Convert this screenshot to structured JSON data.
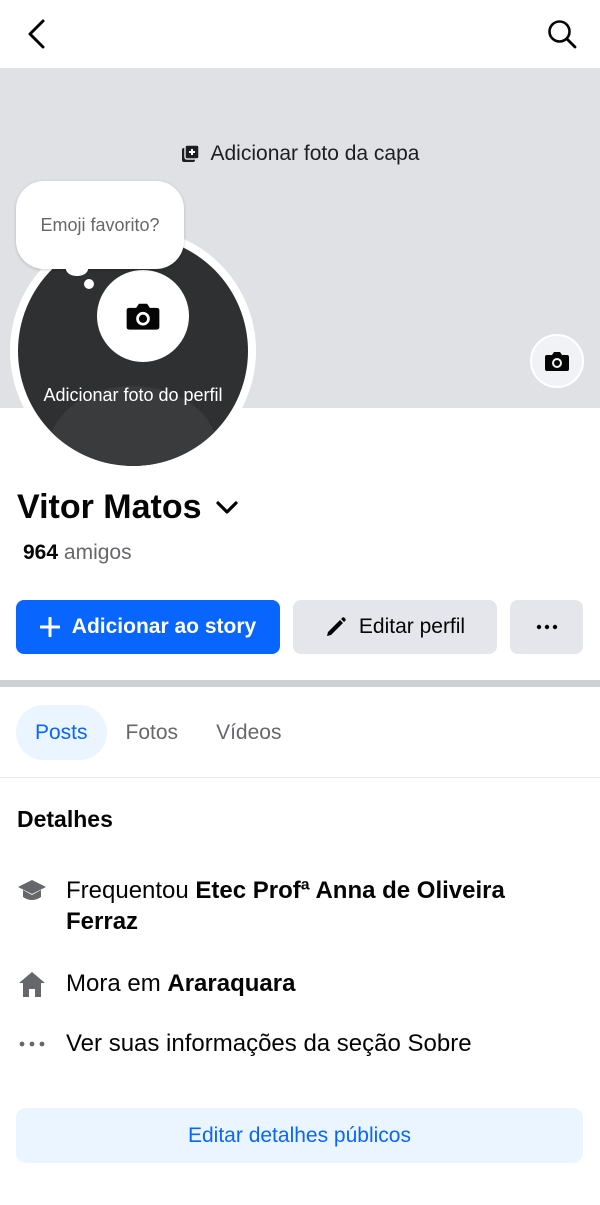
{
  "cover": {
    "add_cover_label": "Adicionar foto da capa"
  },
  "avatar": {
    "add_photo_label": "Adicionar foto do perfil",
    "emoji_prompt": "Emoji favorito?"
  },
  "profile": {
    "name": "Vitor Matos",
    "friends_count": "964",
    "friends_label": "amigos"
  },
  "actions": {
    "add_story": "Adicionar ao story",
    "edit_profile": "Editar perfil",
    "more": "···"
  },
  "tabs": [
    {
      "label": "Posts",
      "active": true
    },
    {
      "label": "Fotos"
    },
    {
      "label": "Vídeos"
    }
  ],
  "details": {
    "title": "Detalhes",
    "education_prefix": "Frequentou ",
    "education_school": "Etec Profª Anna de Oliveira Ferraz",
    "home_prefix": "Mora em ",
    "home_city": "Araraquara",
    "about_link": "Ver suas informações da seção Sobre"
  },
  "edit_public_details": "Editar detalhes públicos",
  "colors": {
    "primary": "#0866ff",
    "cover_bg": "#dfe1e5",
    "secondary_btn": "#e4e6eb",
    "tab_active_bg": "#ebf5ff"
  }
}
